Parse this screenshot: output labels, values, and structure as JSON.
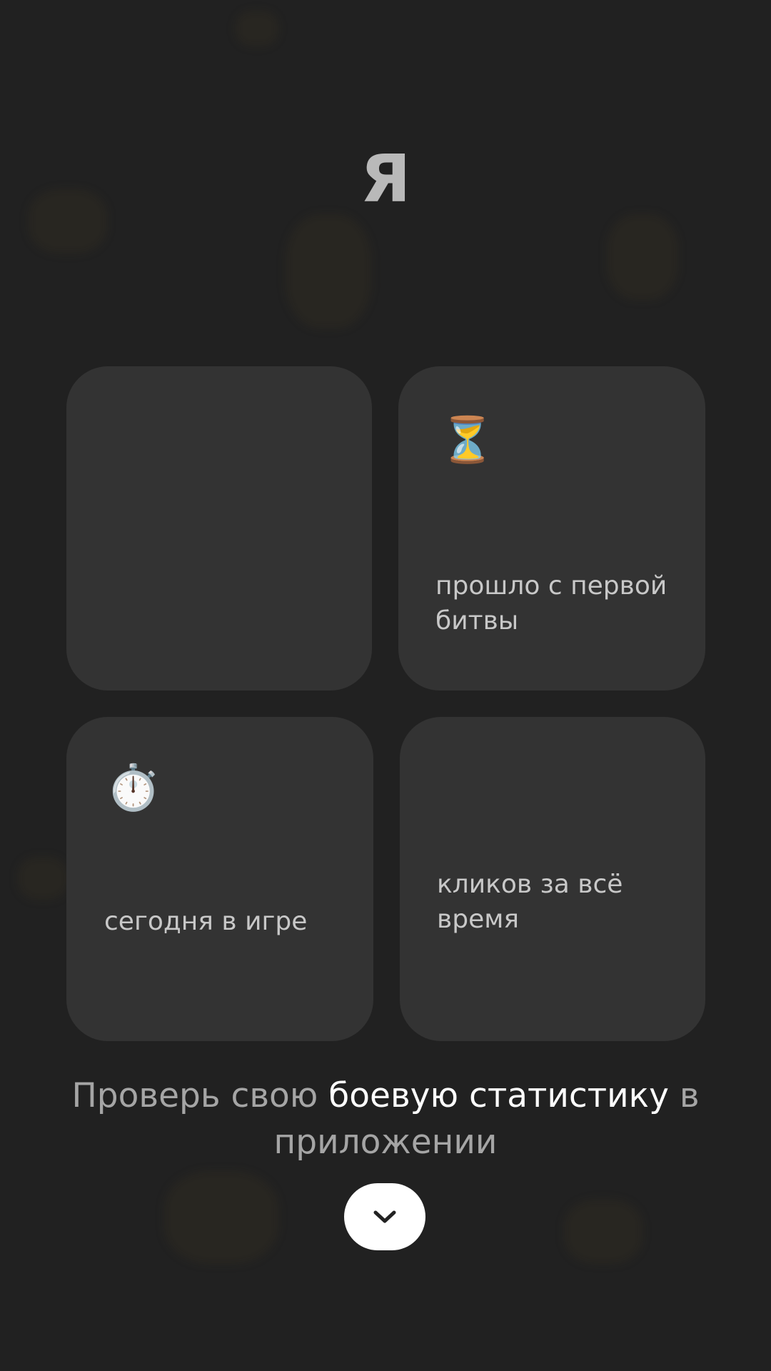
{
  "header": {
    "title": "Я"
  },
  "stats": {
    "cards": [
      {
        "icon": "",
        "label": ""
      },
      {
        "icon": "⏳",
        "icon_name": "hourglass-icon",
        "label": "прошло с первой битвы"
      },
      {
        "icon": "⏱️",
        "icon_name": "stopwatch-icon",
        "label": "сегодня в игре"
      },
      {
        "icon": "",
        "label": "кликов за всё время"
      }
    ]
  },
  "promo": {
    "part1": "Проверь свою ",
    "part2": "боевую статистику",
    "part3": " в приложении"
  },
  "nav": {
    "down_icon": "chevron-down-icon"
  },
  "colors": {
    "background": "#212121",
    "card": "#333333",
    "title": "#b9b9b9",
    "promo_muted": "#a5a5a5",
    "promo_highlight": "#ffffff"
  }
}
